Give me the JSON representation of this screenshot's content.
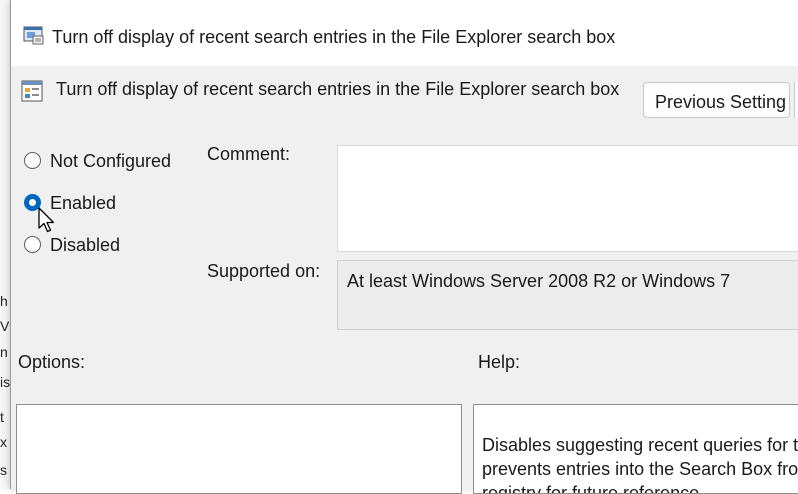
{
  "background_window": {
    "fragments": [
      "h",
      "Vi",
      "n",
      "is",
      "t",
      "x",
      "s"
    ]
  },
  "dialog": {
    "title": "Turn off display of recent search entries in the File Explorer search box",
    "title_icon": "policy-window-icon",
    "header": {
      "icon": "policy-setting-icon",
      "text": "Turn off display of recent search entries in the File Explorer search box",
      "previous_setting_label": "Previous Setting"
    },
    "radios": [
      {
        "label": "Not Configured",
        "selected": false
      },
      {
        "label": "Enabled",
        "selected": true
      },
      {
        "label": "Disabled",
        "selected": false
      }
    ],
    "comment_label": "Comment:",
    "comment_value": "",
    "supported_on_label": "Supported on:",
    "supported_on_value": "At least Windows Server 2008 R2 or Windows 7",
    "options_label": "Options:",
    "help_label": "Help:",
    "help_lines": [
      "Disables suggesting recent queries for the",
      "prevents entries into the Search Box from",
      "registry for future reference."
    ]
  },
  "colors": {
    "accent": "#0067c0",
    "dialog_bg": "#f0f0f0"
  }
}
